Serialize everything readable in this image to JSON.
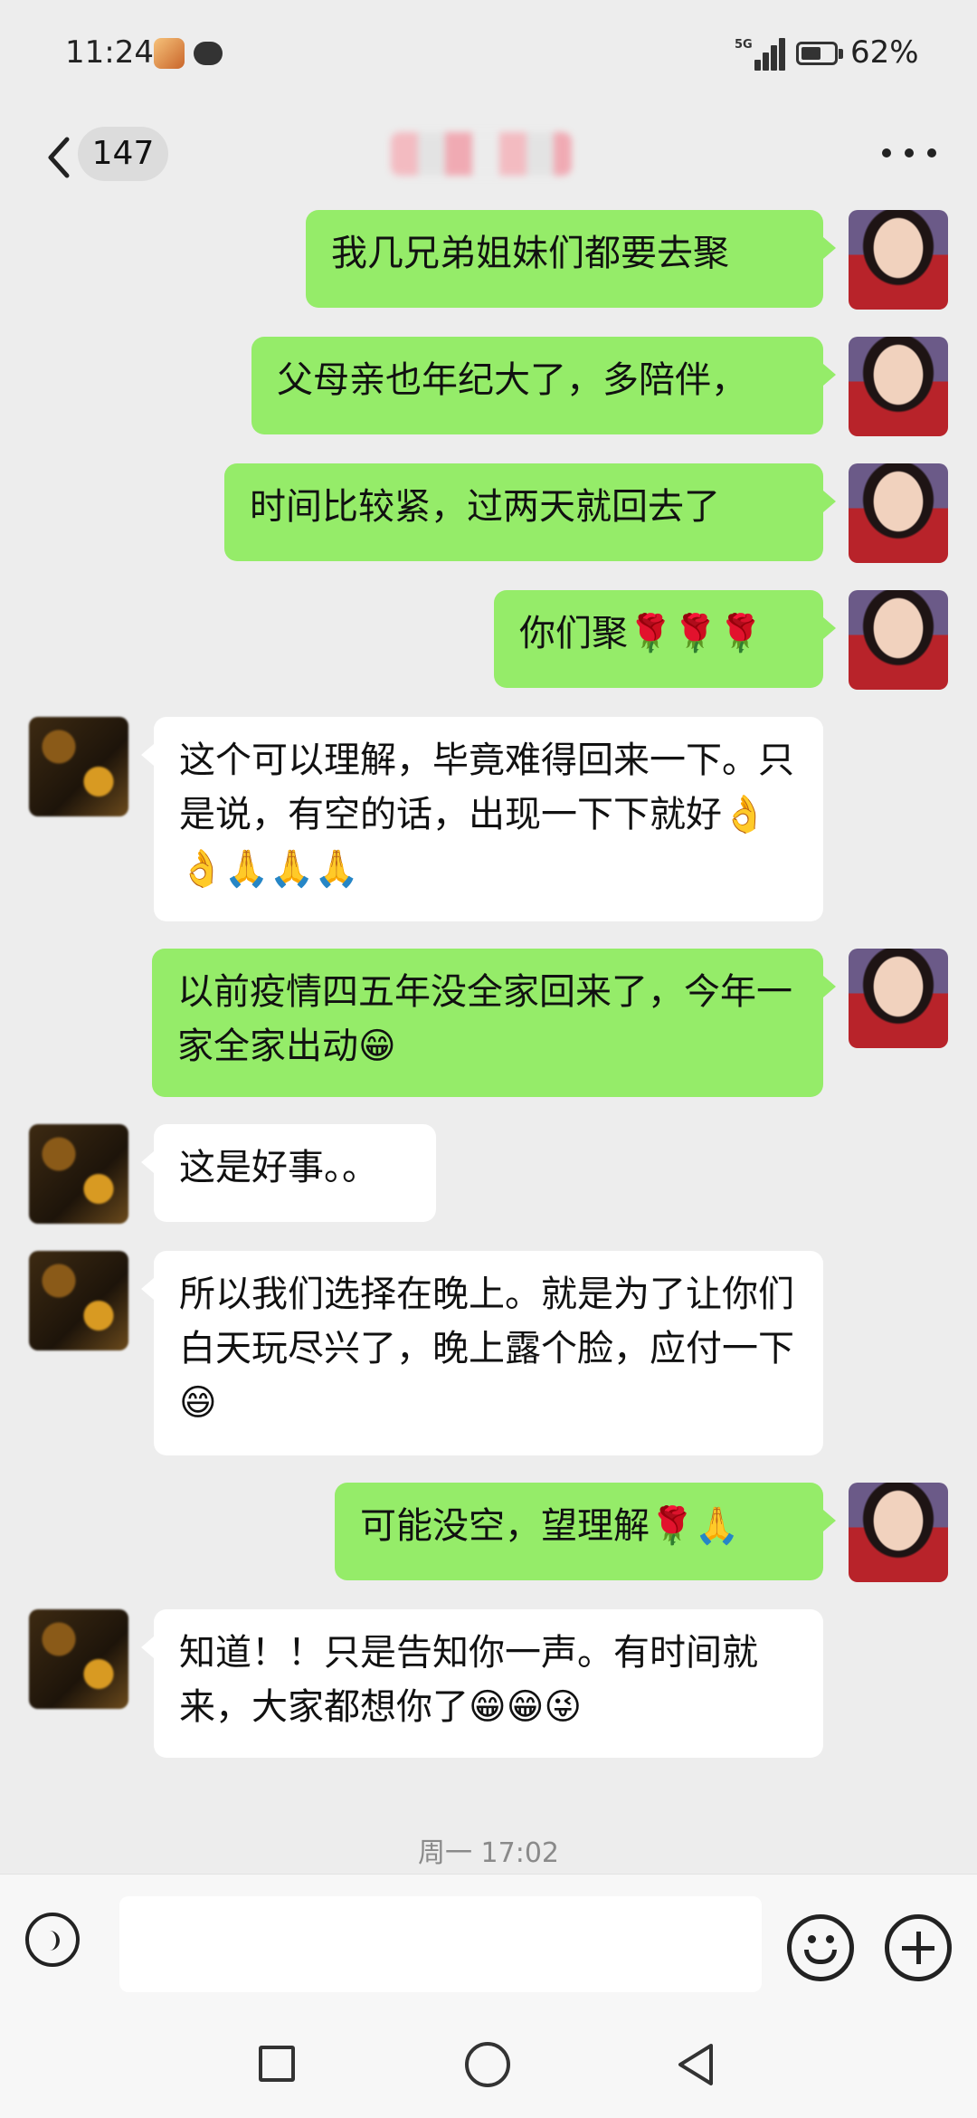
{
  "status_bar": {
    "time": "11:24",
    "network": "5G",
    "battery": "62%",
    "battery_level": 0.62
  },
  "header": {
    "unread_count": "147",
    "title": ""
  },
  "messages": [
    {
      "side": "right",
      "text": "我几兄弟姐妹们都要去聚"
    },
    {
      "side": "right",
      "text": "父母亲也年纪大了，多陪伴，"
    },
    {
      "side": "right",
      "text": "时间比较紧，过两天就回去了"
    },
    {
      "side": "right",
      "text": "你们聚🌹🌹🌹"
    },
    {
      "side": "left",
      "text": "这个可以理解，毕竟难得回来一下。只是说，有空的话，出现一下下就好👌👌🙏🙏🙏"
    },
    {
      "side": "right",
      "text": "以前疫情四五年没全家回来了，今年一家全家出动😁"
    },
    {
      "side": "left",
      "text": "这是好事。。"
    },
    {
      "side": "left",
      "text": "所以我们选择在晚上。就是为了让你们白天玩尽兴了，晚上露个脸，应付一下😄"
    },
    {
      "side": "right",
      "text": "可能没空，望理解🌹🙏"
    },
    {
      "side": "left",
      "text": "知道！！只是告知你一声。有时间就来，大家都想你了😁😁😜"
    }
  ],
  "timestamp": "周一 17:02",
  "input": {
    "value": "",
    "placeholder": ""
  },
  "icons": {
    "back": "back-chevron-icon",
    "more": "more-dots-icon",
    "voice": "voice-icon",
    "emoji": "emoji-icon",
    "plus": "plus-icon",
    "nav_recent": "recent-apps-icon",
    "nav_home": "home-icon",
    "nav_back": "nav-back-icon"
  },
  "colors": {
    "bubble_self": "#95ec69",
    "bubble_other": "#ffffff",
    "background": "#ededed"
  }
}
